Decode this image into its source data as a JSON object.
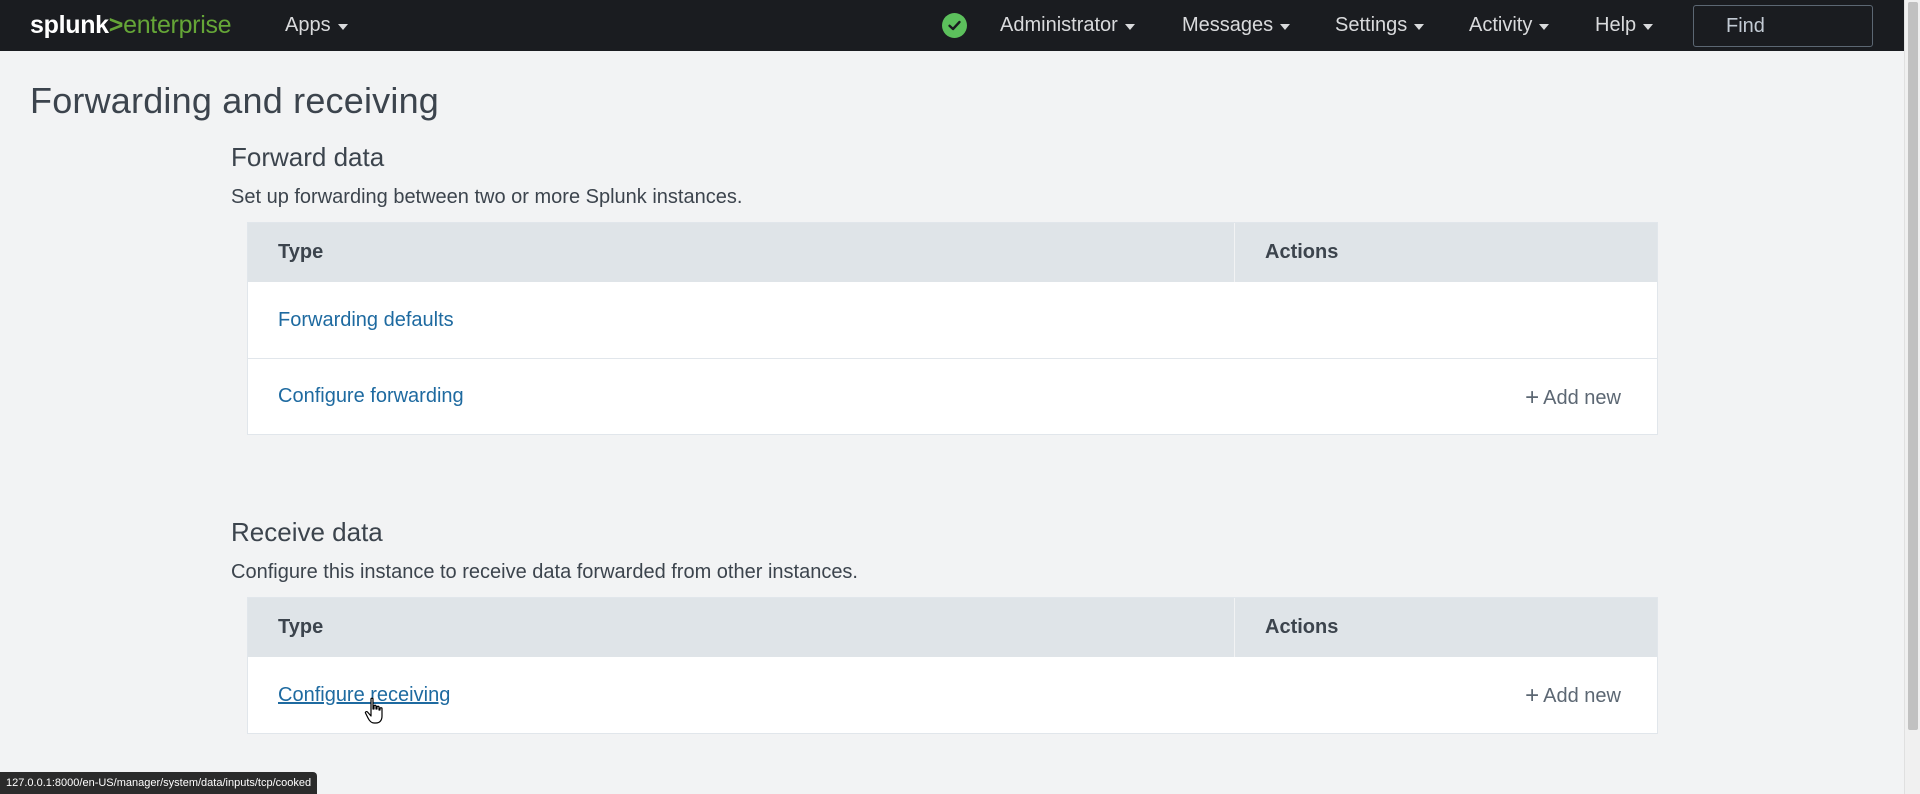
{
  "header": {
    "logo_brand": "splunk",
    "logo_separator": ">",
    "logo_product": "enterprise",
    "apps_label": "Apps",
    "status_icon": "check-circle-icon",
    "user_label": "Administrator",
    "messages_label": "Messages",
    "settings_label": "Settings",
    "activity_label": "Activity",
    "help_label": "Help",
    "find_placeholder": "Find"
  },
  "page": {
    "title": "Forwarding and receiving"
  },
  "forward": {
    "title": "Forward data",
    "description": "Set up forwarding between two or more Splunk instances.",
    "columns": [
      "Type",
      "Actions"
    ],
    "rows": [
      {
        "type": "Forwarding defaults",
        "action": ""
      },
      {
        "type": "Configure forwarding",
        "action": "Add new"
      }
    ]
  },
  "receive": {
    "title": "Receive data",
    "description": "Configure this instance to receive data forwarded from other instances.",
    "columns": [
      "Type",
      "Actions"
    ],
    "rows": [
      {
        "type": "Configure receiving",
        "action": "Add new"
      }
    ]
  },
  "statusbar": {
    "url": "127.0.0.1:8000/en-US/manager/system/data/inputs/tcp/cooked"
  },
  "colors": {
    "header_bg": "#1a1c20",
    "brand_green": "#65a637",
    "status_green": "#5cc05c",
    "link_blue": "#1e6aa0",
    "table_header_bg": "#dfe4e8",
    "page_bg": "#f2f3f4"
  }
}
